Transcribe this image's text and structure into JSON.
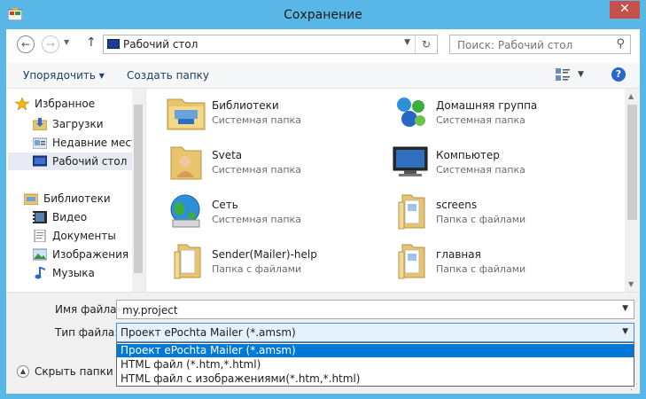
{
  "window": {
    "title": "Сохранение",
    "close_glyph": "✕"
  },
  "address": {
    "location": "Рабочий стол"
  },
  "search": {
    "placeholder": "Поиск: Рабочий стол"
  },
  "toolbar": {
    "organize_label": "Упорядочить ▾",
    "new_folder_label": "Создать папку"
  },
  "navpane": {
    "items": [
      {
        "label": "Избранное",
        "icon": "star-icon"
      },
      {
        "label": "Загрузки",
        "icon": "downloads-icon"
      },
      {
        "label": "Недавние места",
        "icon": "recent-places-icon"
      },
      {
        "label": "Рабочий стол",
        "icon": "desktop-icon",
        "selected": true
      },
      {
        "label": "Библиотеки",
        "icon": "libraries-icon"
      },
      {
        "label": "Видео",
        "icon": "video-icon"
      },
      {
        "label": "Документы",
        "icon": "documents-icon"
      },
      {
        "label": "Изображения",
        "icon": "images-icon"
      },
      {
        "label": "Музыка",
        "icon": "music-icon"
      }
    ]
  },
  "content": {
    "items": [
      {
        "name": "Библиотеки",
        "type": "Системная папка",
        "icon": "libraries-folder-icon"
      },
      {
        "name": "Домашняя группа",
        "type": "Системная папка",
        "icon": "homegroup-icon"
      },
      {
        "name": "Sveta",
        "type": "Системная папка",
        "icon": "user-folder-icon"
      },
      {
        "name": "Компьютер",
        "type": "Системная папка",
        "icon": "computer-icon"
      },
      {
        "name": "Сеть",
        "type": "Системная папка",
        "icon": "network-icon"
      },
      {
        "name": "screens",
        "type": "Папка с файлами",
        "icon": "folder-icon"
      },
      {
        "name": "Sender(Mailer)-help",
        "type": "Папка с файлами",
        "icon": "folder-icon"
      },
      {
        "name": "главная",
        "type": "Папка с файлами",
        "icon": "folder-icon"
      }
    ]
  },
  "form": {
    "filename_label": "Имя файла:",
    "filename_value": "my.project",
    "filetype_label": "Тип файла:",
    "filetype_value": "Проект ePochta Mailer (*.amsm)",
    "filetype_options": [
      "Проект ePochta Mailer (*.amsm)",
      "HTML файл (*.htm,*.html)",
      "HTML файл с изображениями(*.htm,*.html)"
    ],
    "hide_folders_label": "Скрыть папки"
  },
  "colors": {
    "titlebar": "#59b7e8",
    "close": "#c7504b",
    "selection": "#0078d7"
  }
}
